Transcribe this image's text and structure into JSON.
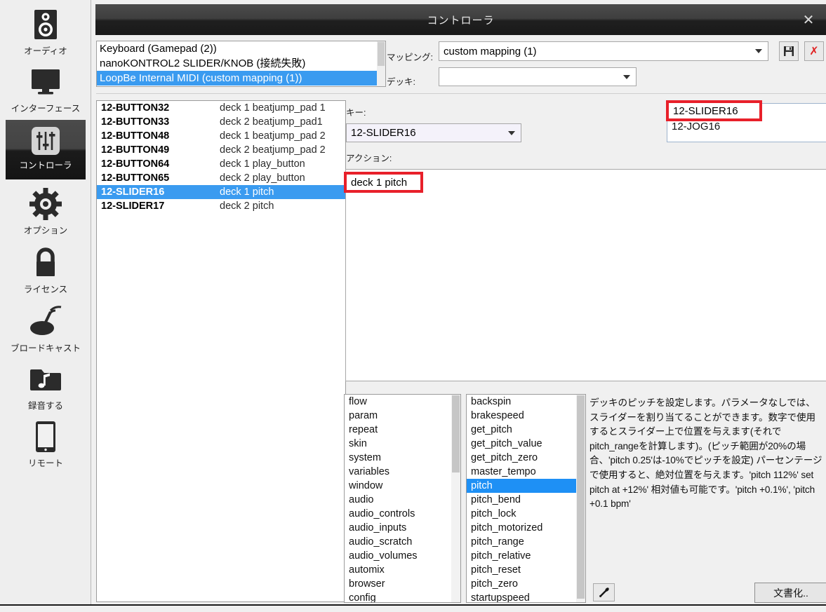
{
  "sidebar": {
    "items": [
      {
        "label": "オーディオ",
        "icon": "speaker-icon",
        "selected": false
      },
      {
        "label": "インターフェース",
        "icon": "monitor-icon",
        "selected": false
      },
      {
        "label": "コントローラ",
        "icon": "sliders-icon",
        "selected": true
      },
      {
        "label": "オプション",
        "icon": "gear-icon",
        "selected": false
      },
      {
        "label": "ライセンス",
        "icon": "lock-icon",
        "selected": false
      },
      {
        "label": "ブロードキャスト",
        "icon": "broadcast-icon",
        "selected": false
      },
      {
        "label": "録音する",
        "icon": "music-folder-icon",
        "selected": false
      },
      {
        "label": "リモート",
        "icon": "tablet-icon",
        "selected": false
      }
    ]
  },
  "window": {
    "title": "コントローラ",
    "close_label": "✕"
  },
  "devices": {
    "rows": [
      {
        "text": "Keyboard (Gamepad (2))",
        "selected": false
      },
      {
        "text": "nanoKONTROL2 SLIDER/KNOB (接続失敗)",
        "selected": false
      },
      {
        "text": "LoopBe Internal MIDI (custom mapping (1))",
        "selected": true
      }
    ]
  },
  "mapping_field": {
    "label": "マッピング:",
    "value": "custom mapping (1)",
    "save_icon": "floppy-save-icon",
    "delete_icon": "red-x-delete-icon",
    "delete_label": "✗"
  },
  "deck_field": {
    "label": "デッキ:",
    "value": ""
  },
  "map_list": {
    "rows": [
      {
        "key": "12-BUTTON32",
        "value": "deck 1 beatjump_pad 1",
        "selected": false
      },
      {
        "key": "12-BUTTON33",
        "value": "deck 2 beatjump_pad1",
        "selected": false
      },
      {
        "key": "12-BUTTON48",
        "value": "deck 1 beatjump_pad 2",
        "selected": false
      },
      {
        "key": "12-BUTTON49",
        "value": "deck 2 beatjump_pad 2",
        "selected": false
      },
      {
        "key": "12-BUTTON64",
        "value": "deck 1 play_button",
        "selected": false
      },
      {
        "key": "12-BUTTON65",
        "value": "deck 2 play_button",
        "selected": false
      },
      {
        "key": "12-SLIDER16",
        "value": "deck 1 pitch",
        "selected": true
      },
      {
        "key": "12-SLIDER17",
        "value": "deck 2 pitch",
        "selected": false
      }
    ]
  },
  "key_field": {
    "label": "キー:",
    "value": "12-SLIDER16"
  },
  "action_field": {
    "label": "アクション:",
    "value": "deck 1 pitch"
  },
  "slider_box": {
    "rows": [
      {
        "text": "12-SLIDER16"
      },
      {
        "text": "12-JOG16"
      }
    ]
  },
  "annotations": {
    "slider_box_highlight": "12-SLIDER16",
    "action_highlight": "deck 1 pitch"
  },
  "category_list": {
    "rows": [
      {
        "text": "flow",
        "selected": false
      },
      {
        "text": "param",
        "selected": false
      },
      {
        "text": "repeat",
        "selected": false
      },
      {
        "text": "skin",
        "selected": false
      },
      {
        "text": "system",
        "selected": false
      },
      {
        "text": "variables",
        "selected": false
      },
      {
        "text": "window",
        "selected": false
      },
      {
        "text": "audio",
        "selected": false
      },
      {
        "text": "audio_controls",
        "selected": false
      },
      {
        "text": "audio_inputs",
        "selected": false
      },
      {
        "text": "audio_scratch",
        "selected": false
      },
      {
        "text": "audio_volumes",
        "selected": false
      },
      {
        "text": "automix",
        "selected": false
      },
      {
        "text": "browser",
        "selected": false
      },
      {
        "text": "config",
        "selected": false
      }
    ]
  },
  "command_list": {
    "rows": [
      {
        "text": "backspin",
        "selected": false
      },
      {
        "text": "brakespeed",
        "selected": false
      },
      {
        "text": "get_pitch",
        "selected": false
      },
      {
        "text": "get_pitch_value",
        "selected": false
      },
      {
        "text": "get_pitch_zero",
        "selected": false
      },
      {
        "text": "master_tempo",
        "selected": false
      },
      {
        "text": "pitch",
        "selected": true
      },
      {
        "text": "pitch_bend",
        "selected": false
      },
      {
        "text": "pitch_lock",
        "selected": false
      },
      {
        "text": "pitch_motorized",
        "selected": false
      },
      {
        "text": "pitch_range",
        "selected": false
      },
      {
        "text": "pitch_relative",
        "selected": false
      },
      {
        "text": "pitch_reset",
        "selected": false
      },
      {
        "text": "pitch_zero",
        "selected": false
      },
      {
        "text": "startupspeed",
        "selected": false
      }
    ]
  },
  "help": {
    "text": "デッキのピッチを設定します。パラメータなしでは、スライダーを割り当てることができます。数字で使用するとスライダー上で位置を与えます(それでpitch_rangeを計算します)。(ピッチ範囲が20%の場合、'pitch 0.25'は-10%でピッチを設定) パーセンテージで使用すると、絶対位置を与えます。'pitch 112%' set pitch at +12%'  相対値も可能です。'pitch +0.1%', 'pitch +0.1 bpm'"
  },
  "buttons": {
    "pick_icon": "eyedropper-icon",
    "doc_label": "文書化.."
  },
  "colors": {
    "selection_blue": "#3a9bf0",
    "list_selection_blue": "#1e90f5",
    "annotation_red": "#e8202a",
    "titlebar_dark": "#1f1f1f",
    "panel_bg": "#f0f0f0"
  }
}
